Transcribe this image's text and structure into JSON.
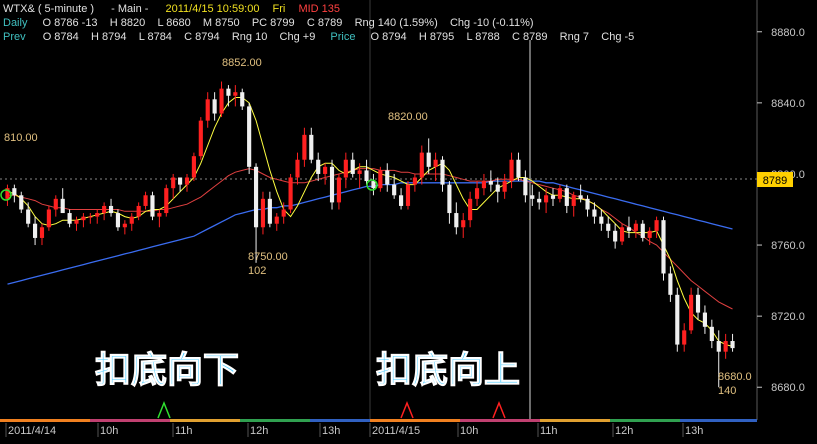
{
  "header": {
    "symbol": "WTX& ( 5-minute )",
    "panel": "- Main -",
    "datetime": "2011/4/15 10:59:00",
    "weekday": "Fri",
    "mid": "MID 135",
    "daily_label": "Daily",
    "daily_values": "O 8786 -13    H 8820    L 8680    M 8750    PC 8799    C 8789    Rng 140 (1.59%)    Chg -10 (-0.11%)",
    "prev_label": "Prev",
    "prev_values": "O 8784    H 8794    L 8784    C 8794    Rng 10    Chg +9",
    "price_label": "Price",
    "price_values": "O 8794    H 8795    L 8788    C 8789    Rng 7    Chg -5"
  },
  "annotations": {
    "high1": "8852.00",
    "low1": "8750.00",
    "low1_range": "102",
    "high2": "8820.00",
    "low2": "8680.0",
    "low2_range": "140",
    "left_cut": "810.00",
    "current_price": "8789",
    "text_left": "扣底向下",
    "text_right": "扣底向上"
  },
  "colors": {
    "up": "#ff2020",
    "down": "#f0f0f0",
    "ma_short": "#ffff40",
    "ma_mid": "#e04040",
    "ma_long": "#3a6cf0",
    "axis": "#c8c8c8",
    "header_green": "#40c040",
    "header_yellow": "#f0e020",
    "header_cyan": "#40c8c8",
    "big_text": "#40c8ff"
  },
  "chart_data": {
    "type": "candlestick",
    "ylim": [
      8670,
      8890
    ],
    "yticks": [
      8680,
      8720,
      8760,
      8800,
      8840,
      8880
    ],
    "xticks": [
      "2011/4/14",
      "10h",
      "11h",
      "12h",
      "13h",
      "2011/4/15",
      "10h",
      "11h",
      "12h",
      "13h"
    ],
    "reference_line": 8789,
    "candles": [
      [
        8786,
        8794,
        8782,
        8792
      ],
      [
        8792,
        8794,
        8784,
        8788
      ],
      [
        8788,
        8790,
        8778,
        8780
      ],
      [
        8780,
        8784,
        8770,
        8772
      ],
      [
        8772,
        8776,
        8760,
        8764
      ],
      [
        8764,
        8772,
        8760,
        8770
      ],
      [
        8770,
        8782,
        8768,
        8780
      ],
      [
        8780,
        8788,
        8776,
        8786
      ],
      [
        8786,
        8792,
        8782,
        8778
      ],
      [
        8778,
        8780,
        8770,
        8772
      ],
      [
        8772,
        8776,
        8768,
        8774
      ],
      [
        8774,
        8778,
        8770,
        8776
      ],
      [
        8776,
        8778,
        8772,
        8776
      ],
      [
        8776,
        8780,
        8772,
        8778
      ],
      [
        8778,
        8784,
        8774,
        8782
      ],
      [
        8782,
        8786,
        8776,
        8778
      ],
      [
        8778,
        8780,
        8768,
        8770
      ],
      [
        8770,
        8774,
        8766,
        8772
      ],
      [
        8772,
        8778,
        8768,
        8776
      ],
      [
        8776,
        8784,
        8774,
        8782
      ],
      [
        8782,
        8790,
        8780,
        8788
      ],
      [
        8788,
        8790,
        8774,
        8776
      ],
      [
        8776,
        8780,
        8770,
        8778
      ],
      [
        8778,
        8794,
        8776,
        8792
      ],
      [
        8792,
        8800,
        8786,
        8798
      ],
      [
        8798,
        8796,
        8790,
        8794
      ],
      [
        8794,
        8800,
        8790,
        8798
      ],
      [
        8798,
        8812,
        8796,
        8810
      ],
      [
        8810,
        8832,
        8808,
        8830
      ],
      [
        8830,
        8846,
        8826,
        8842
      ],
      [
        8842,
        8846,
        8830,
        8834
      ],
      [
        8834,
        8852,
        8832,
        8848
      ],
      [
        8848,
        8850,
        8838,
        8844
      ],
      [
        8844,
        8850,
        8838,
        8846
      ],
      [
        8846,
        8848,
        8836,
        8838
      ],
      [
        8838,
        8840,
        8800,
        8804
      ],
      [
        8804,
        8806,
        8750,
        8770
      ],
      [
        8770,
        8790,
        8766,
        8786
      ],
      [
        8786,
        8790,
        8770,
        8772
      ],
      [
        8772,
        8778,
        8768,
        8776
      ],
      [
        8776,
        8784,
        8772,
        8780
      ],
      [
        8780,
        8800,
        8778,
        8798
      ],
      [
        8798,
        8812,
        8794,
        8808
      ],
      [
        8808,
        8826,
        8804,
        8822
      ],
      [
        8822,
        8826,
        8806,
        8808
      ],
      [
        8808,
        8812,
        8796,
        8800
      ],
      [
        8800,
        8806,
        8794,
        8804
      ],
      [
        8804,
        8808,
        8780,
        8784
      ],
      [
        8784,
        8800,
        8780,
        8798
      ],
      [
        8798,
        8812,
        8792,
        8808
      ],
      [
        8808,
        8812,
        8798,
        8800
      ],
      [
        8800,
        8806,
        8792,
        8802
      ],
      [
        8802,
        8808,
        8794,
        8796
      ],
      [
        8796,
        8800,
        8788,
        8792
      ],
      [
        8792,
        8804,
        8790,
        8802
      ],
      [
        8802,
        8806,
        8790,
        8794
      ],
      [
        8794,
        8800,
        8786,
        8788
      ],
      [
        8788,
        8792,
        8780,
        8782
      ],
      [
        8782,
        8796,
        8780,
        8794
      ],
      [
        8794,
        8800,
        8790,
        8798
      ],
      [
        8798,
        8816,
        8794,
        8812
      ],
      [
        8812,
        8820,
        8800,
        8804
      ],
      [
        8804,
        8812,
        8796,
        8808
      ],
      [
        8808,
        8810,
        8790,
        8794
      ],
      [
        8794,
        8796,
        8772,
        8778
      ],
      [
        8778,
        8784,
        8766,
        8770
      ],
      [
        8770,
        8778,
        8764,
        8774
      ],
      [
        8774,
        8790,
        8770,
        8786
      ],
      [
        8786,
        8796,
        8782,
        8792
      ],
      [
        8792,
        8800,
        8788,
        8796
      ],
      [
        8796,
        8802,
        8790,
        8794
      ],
      [
        8794,
        8798,
        8784,
        8790
      ],
      [
        8790,
        8800,
        8786,
        8796
      ],
      [
        8796,
        8812,
        8792,
        8808
      ],
      [
        8808,
        8812,
        8796,
        8798
      ],
      [
        8798,
        8802,
        8784,
        8788
      ],
      [
        8788,
        8794,
        8782,
        8786
      ],
      [
        8786,
        8790,
        8780,
        8784
      ],
      [
        8784,
        8792,
        8778,
        8788
      ],
      [
        8788,
        8792,
        8782,
        8786
      ],
      [
        8786,
        8794,
        8784,
        8792
      ],
      [
        8792,
        8794,
        8778,
        8782
      ],
      [
        8782,
        8790,
        8776,
        8788
      ],
      [
        8788,
        8794,
        8784,
        8786
      ],
      [
        8786,
        8788,
        8776,
        8780
      ],
      [
        8780,
        8784,
        8772,
        8776
      ],
      [
        8776,
        8780,
        8768,
        8772
      ],
      [
        8772,
        8776,
        8764,
        8768
      ],
      [
        8768,
        8772,
        8758,
        8762
      ],
      [
        8762,
        8772,
        8760,
        8770
      ],
      [
        8770,
        8776,
        8764,
        8768
      ],
      [
        8768,
        8774,
        8764,
        8772
      ],
      [
        8772,
        8774,
        8762,
        8764
      ],
      [
        8764,
        8770,
        8760,
        8768
      ],
      [
        8768,
        8776,
        8764,
        8774
      ],
      [
        8774,
        8776,
        8740,
        8744
      ],
      [
        8744,
        8748,
        8728,
        8732
      ],
      [
        8732,
        8736,
        8700,
        8704
      ],
      [
        8704,
        8716,
        8700,
        8712
      ],
      [
        8712,
        8736,
        8710,
        8732
      ],
      [
        8732,
        8736,
        8718,
        8722
      ],
      [
        8722,
        8726,
        8710,
        8714
      ],
      [
        8714,
        8718,
        8702,
        8706
      ],
      [
        8706,
        8712,
        8680,
        8700
      ],
      [
        8700,
        8710,
        8696,
        8706
      ],
      [
        8706,
        8710,
        8700,
        8702
      ]
    ],
    "ma_short": [
      8790,
      8789,
      8786,
      8782,
      8776,
      8772,
      8771,
      8772,
      8774,
      8774,
      8774,
      8775,
      8776,
      8777,
      8778,
      8779,
      8778,
      8776,
      8775,
      8776,
      8779,
      8780,
      8780,
      8782,
      8786,
      8790,
      8794,
      8798,
      8806,
      8816,
      8826,
      8834,
      8840,
      8843,
      8843,
      8840,
      8830,
      8816,
      8802,
      8790,
      8780,
      8776,
      8782,
      8790,
      8798,
      8804,
      8806,
      8806,
      8802,
      8800,
      8802,
      8804,
      8804,
      8802,
      8800,
      8799,
      8798,
      8796,
      8794,
      8794,
      8798,
      8802,
      8804,
      8806,
      8802,
      8794,
      8786,
      8780,
      8780,
      8784,
      8788,
      8792,
      8794,
      8796,
      8798,
      8798,
      8796,
      8793,
      8790,
      8788,
      8788,
      8787,
      8786,
      8786,
      8785,
      8783,
      8780,
      8776,
      8772,
      8768,
      8767,
      8767,
      8767,
      8767,
      8768,
      8760,
      8752,
      8740,
      8730,
      8722,
      8718,
      8716,
      8712,
      8706,
      8704,
      8703
    ],
    "ma_mid": [
      8788,
      8788,
      8787,
      8786,
      8785,
      8783,
      8782,
      8781,
      8781,
      8780,
      8780,
      8780,
      8780,
      8780,
      8780,
      8780,
      8780,
      8779,
      8779,
      8779,
      8779,
      8779,
      8780,
      8780,
      8781,
      8782,
      8783,
      8785,
      8787,
      8790,
      8793,
      8796,
      8799,
      8801,
      8802,
      8803,
      8802,
      8800,
      8798,
      8797,
      8796,
      8795,
      8795,
      8795,
      8796,
      8797,
      8798,
      8799,
      8800,
      8801,
      8802,
      8803,
      8803,
      8803,
      8802,
      8802,
      8802,
      8801,
      8801,
      8800,
      8800,
      8800,
      8800,
      8800,
      8799,
      8798,
      8797,
      8796,
      8796,
      8796,
      8796,
      8797,
      8797,
      8797,
      8797,
      8796,
      8795,
      8794,
      8793,
      8792,
      8791,
      8790,
      8788,
      8787,
      8785,
      8783,
      8780,
      8778,
      8775,
      8772,
      8770,
      8767,
      8765,
      8762,
      8760,
      8756,
      8752,
      8748,
      8744,
      8740,
      8737,
      8734,
      8731,
      8728,
      8726,
      8724
    ],
    "ma_long": [
      8738,
      8739,
      8740,
      8741,
      8742,
      8743,
      8744,
      8745,
      8746,
      8747,
      8748,
      8749,
      8750,
      8751,
      8752,
      8753,
      8754,
      8755,
      8756,
      8757,
      8758,
      8759,
      8760,
      8761,
      8762,
      8763,
      8764,
      8765,
      8767,
      8769,
      8771,
      8773,
      8775,
      8777,
      8778,
      8779,
      8780,
      8780,
      8781,
      8781,
      8782,
      8782,
      8783,
      8784,
      8785,
      8786,
      8787,
      8788,
      8789,
      8790,
      8791,
      8792,
      8793,
      8793,
      8794,
      8794,
      8794,
      8795,
      8795,
      8795,
      8795,
      8795,
      8795,
      8795,
      8795,
      8795,
      8795,
      8795,
      8795,
      8795,
      8796,
      8796,
      8796,
      8796,
      8796,
      8796,
      8796,
      8796,
      8795,
      8795,
      8794,
      8793,
      8792,
      8791,
      8790,
      8789,
      8788,
      8787,
      8786,
      8785,
      8784,
      8783,
      8782,
      8781,
      8780,
      8779,
      8778,
      8777,
      8776,
      8775,
      8774,
      8773,
      8772,
      8771,
      8770,
      8769
    ]
  }
}
